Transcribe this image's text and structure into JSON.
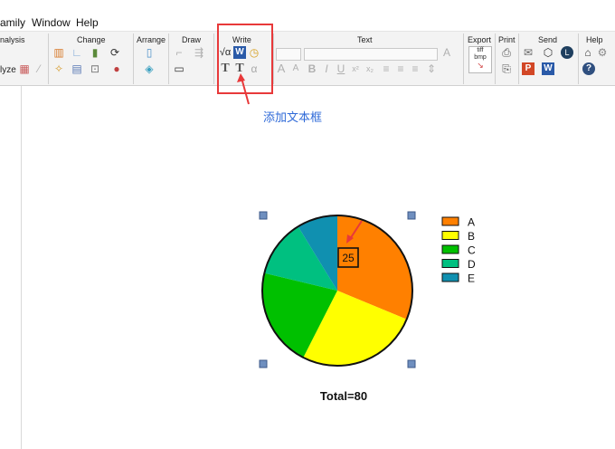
{
  "menu": {
    "family": "amily",
    "window": "Window",
    "help": "Help"
  },
  "ribbon": {
    "groups": {
      "analysis": "nalysis",
      "analyze": "lyze",
      "change": "Change",
      "arrange": "Arrange",
      "draw": "Draw",
      "write": "Write",
      "text": "Text",
      "export": "Export",
      "print": "Print",
      "send": "Send",
      "help": "Help"
    },
    "icons": {
      "sqrt": "√α",
      "word": "W",
      "text_t": "T",
      "textbox_t": "T",
      "alpha": "α",
      "grow_font": "A",
      "shrink_font": "A",
      "bold": "B",
      "italic": "I",
      "underline": "U",
      "superscript": "x²",
      "subscript": "x₂",
      "font_color": "A",
      "export_tiff": "tiff",
      "export_bmp": "bmp",
      "send_ppt": "P",
      "send_word": "W",
      "send_l": "L"
    }
  },
  "annotation": {
    "callout_text": "添加文本框",
    "highlight_color": "#e8393a",
    "callout_color": "#2f6ad8"
  },
  "chart_data": {
    "type": "pie",
    "categories": [
      "A",
      "B",
      "C",
      "D",
      "E"
    ],
    "values": [
      25,
      21,
      17,
      10,
      7
    ],
    "colors": [
      "#ff8000",
      "#ffff00",
      "#00c000",
      "#00c080",
      "#1090b0"
    ],
    "legend_position": "right",
    "data_label": "25",
    "total_label": "Total=80"
  }
}
